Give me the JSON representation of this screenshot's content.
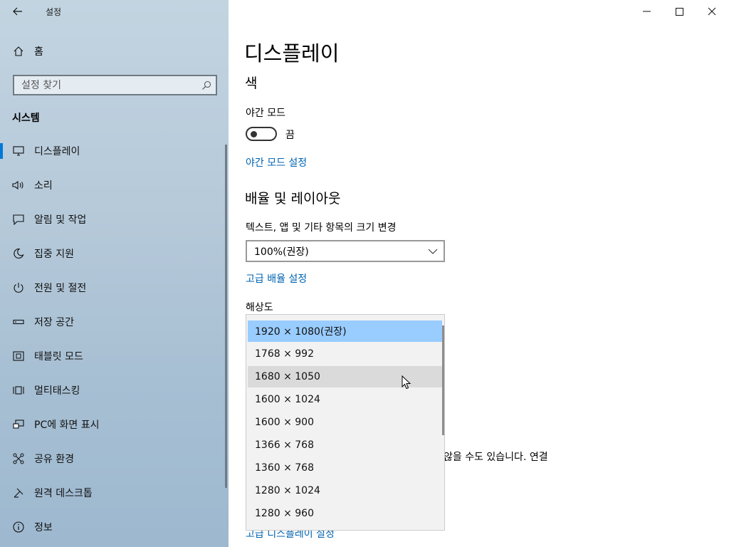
{
  "window": {
    "title": "설정",
    "controls": {
      "minimize": "—",
      "maximize": "☐",
      "close": "✕"
    }
  },
  "sidebar": {
    "home_label": "홈",
    "search_placeholder": "설정 찾기",
    "section_title": "시스템",
    "items": [
      {
        "label": "디스플레이",
        "icon": "monitor-icon",
        "selected": true
      },
      {
        "label": "소리",
        "icon": "speaker-icon"
      },
      {
        "label": "알림 및 작업",
        "icon": "notification-icon"
      },
      {
        "label": "집중 지원",
        "icon": "moon-icon"
      },
      {
        "label": "전원 및 절전",
        "icon": "power-icon"
      },
      {
        "label": "저장 공간",
        "icon": "storage-icon"
      },
      {
        "label": "태블릿 모드",
        "icon": "tablet-icon"
      },
      {
        "label": "멀티태스킹",
        "icon": "multitasking-icon"
      },
      {
        "label": "PC에 화면 표시",
        "icon": "project-icon"
      },
      {
        "label": "공유 환경",
        "icon": "shared-experiences-icon"
      },
      {
        "label": "원격 데스크톱",
        "icon": "remote-desktop-icon"
      },
      {
        "label": "정보",
        "icon": "info-icon"
      }
    ]
  },
  "main": {
    "page_title": "디스플레이",
    "color_heading": "색",
    "night_light_label": "야간 모드",
    "night_light_state": "끔",
    "night_light_on": false,
    "night_light_settings_link": "야간 모드 설정",
    "scale_heading": "배율 및 레이아웃",
    "scale_label": "텍스트, 앱 및 기타 항목의 크기 변경",
    "scale_value": "100%(권장)",
    "advanced_scaling_link": "고급 배율 설정",
    "resolution_label": "해상도",
    "resolution_options": [
      "1920 × 1080(권장)",
      "1768 × 992",
      "1680 × 1050",
      "1600 × 1024",
      "1600 × 900",
      "1366 × 768",
      "1360 × 768",
      "1280 × 1024",
      "1280 × 960"
    ],
    "resolution_selected_index": 0,
    "resolution_hover_index": 2,
    "partial_text": "않을 수도 있습니다. 연결",
    "advanced_display_link": "고급 디스플레이 설정"
  },
  "colors": {
    "accent": "#0078d7",
    "link": "#0063b1",
    "selected_option": "#99ccff",
    "hover_option": "#dadada"
  }
}
